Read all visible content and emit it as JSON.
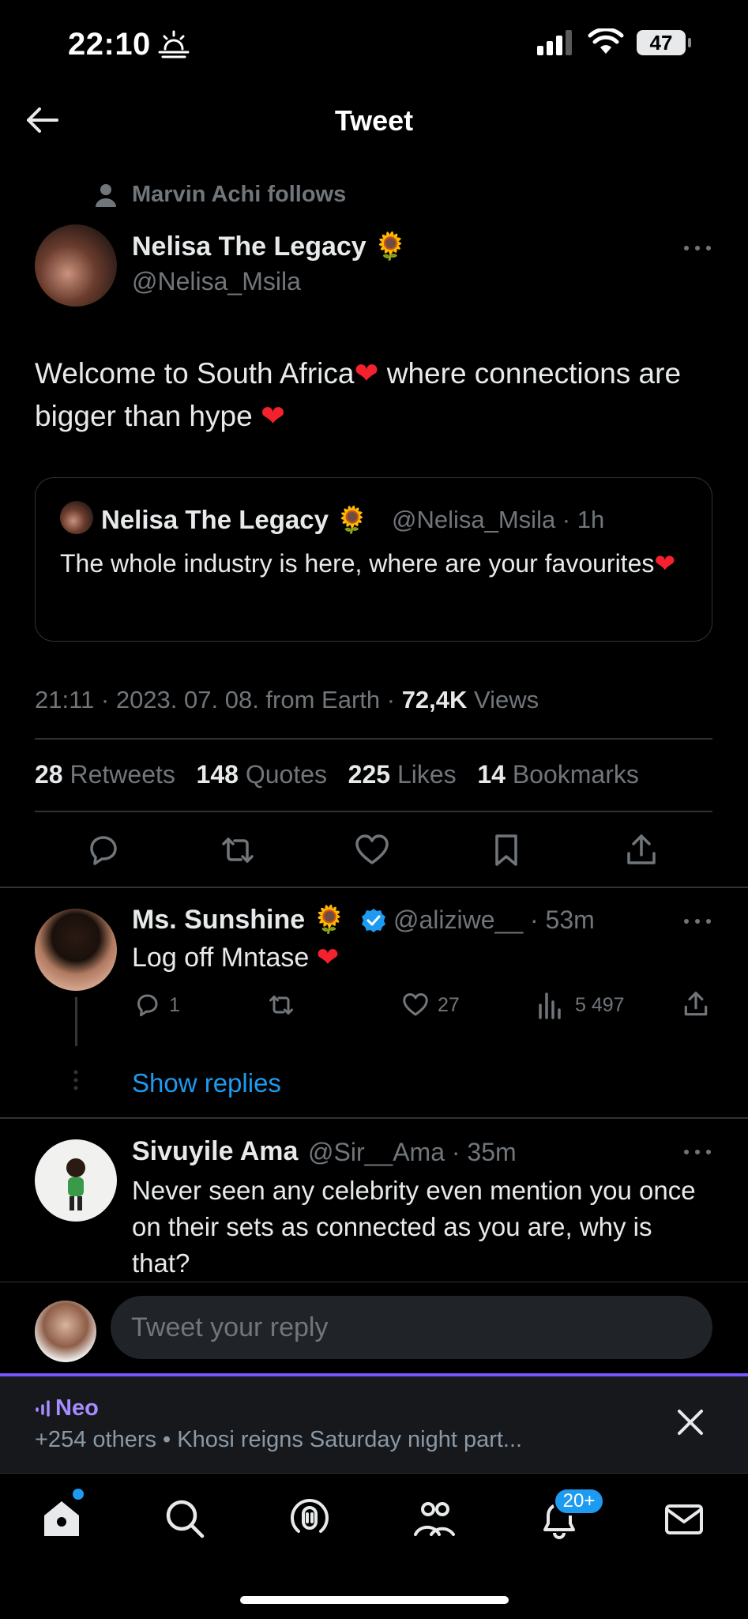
{
  "status_bar": {
    "time": "22:10",
    "battery": "47"
  },
  "header": {
    "title": "Tweet"
  },
  "social_context": "Marvin Achi follows",
  "tweet": {
    "author_name": "Nelisa The Legacy",
    "author_emoji": "🌻",
    "author_handle": "@Nelisa_Msila",
    "text_part1": "Welcome to South Africa",
    "text_part2": " where connections are bigger than hype ",
    "heart": "❤",
    "quote": {
      "name": "Nelisa The Legacy",
      "emoji": "🌻",
      "handle_time": "@Nelisa_Msila · 1h",
      "text": "The whole industry is here, where are your favourites"
    },
    "meta_prefix": "21:11 · 2023. 07. 08. from Earth · ",
    "views_count": "72,4K",
    "views_label": " Views",
    "stats": {
      "retweets_count": "28",
      "retweets_label": "Retweets",
      "quotes_count": "148",
      "quotes_label": "Quotes",
      "likes_count": "225",
      "likes_label": "Likes",
      "bookmarks_count": "14",
      "bookmarks_label": "Bookmarks"
    }
  },
  "replies": [
    {
      "name": "Ms. Sunshine",
      "emoji": "🌻",
      "handle_time": "@aliziwe__ · 53m",
      "text": "Log off Mntase ",
      "reply_count": "1",
      "like_count": "27",
      "view_count": "5 497",
      "show_replies": "Show replies"
    },
    {
      "name": "Sivuyile Ama",
      "handle_time": "@Sir__Ama · 35m",
      "text": "Never seen any celebrity even mention you once on their sets as connected as you are, why is that?"
    }
  ],
  "reply_bar": {
    "placeholder": "Tweet your reply"
  },
  "spaces": {
    "host": "Neo",
    "subtitle": "+254 others • Khosi reigns Saturday night part..."
  },
  "tab_bar": {
    "notifications_badge": "20+"
  },
  "colors": {
    "accent": "#1d9bf0",
    "heart": "#f4212e",
    "spaces": "#7856ff",
    "muted": "#71767b"
  }
}
